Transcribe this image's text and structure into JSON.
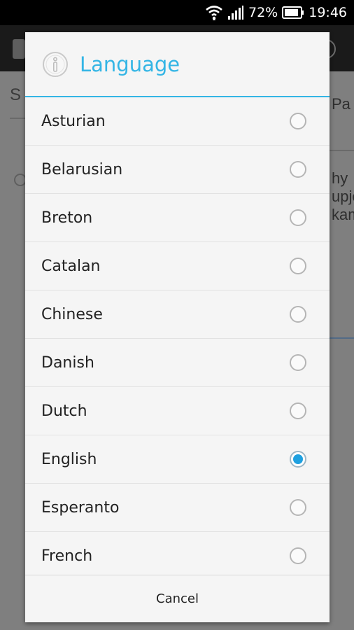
{
  "status_bar": {
    "battery_percent": "72%",
    "time": "19:46",
    "icons": [
      "wifi-icon",
      "signal-icon",
      "battery-icon"
    ]
  },
  "background": {
    "heading_fragment": "S",
    "right_fragment_1": "Pa",
    "right_text_lines": [
      "hy",
      "upje",
      "kam"
    ]
  },
  "dialog": {
    "title": "Language",
    "icon": "info-icon",
    "accent_color": "#33b5e5",
    "options": [
      {
        "label": "Asturian",
        "selected": false
      },
      {
        "label": "Belarusian",
        "selected": false
      },
      {
        "label": "Breton",
        "selected": false
      },
      {
        "label": "Catalan",
        "selected": false
      },
      {
        "label": "Chinese",
        "selected": false
      },
      {
        "label": "Danish",
        "selected": false
      },
      {
        "label": "Dutch",
        "selected": false
      },
      {
        "label": "English",
        "selected": true
      },
      {
        "label": "Esperanto",
        "selected": false
      },
      {
        "label": "French",
        "selected": false
      }
    ],
    "cancel_label": "Cancel"
  }
}
